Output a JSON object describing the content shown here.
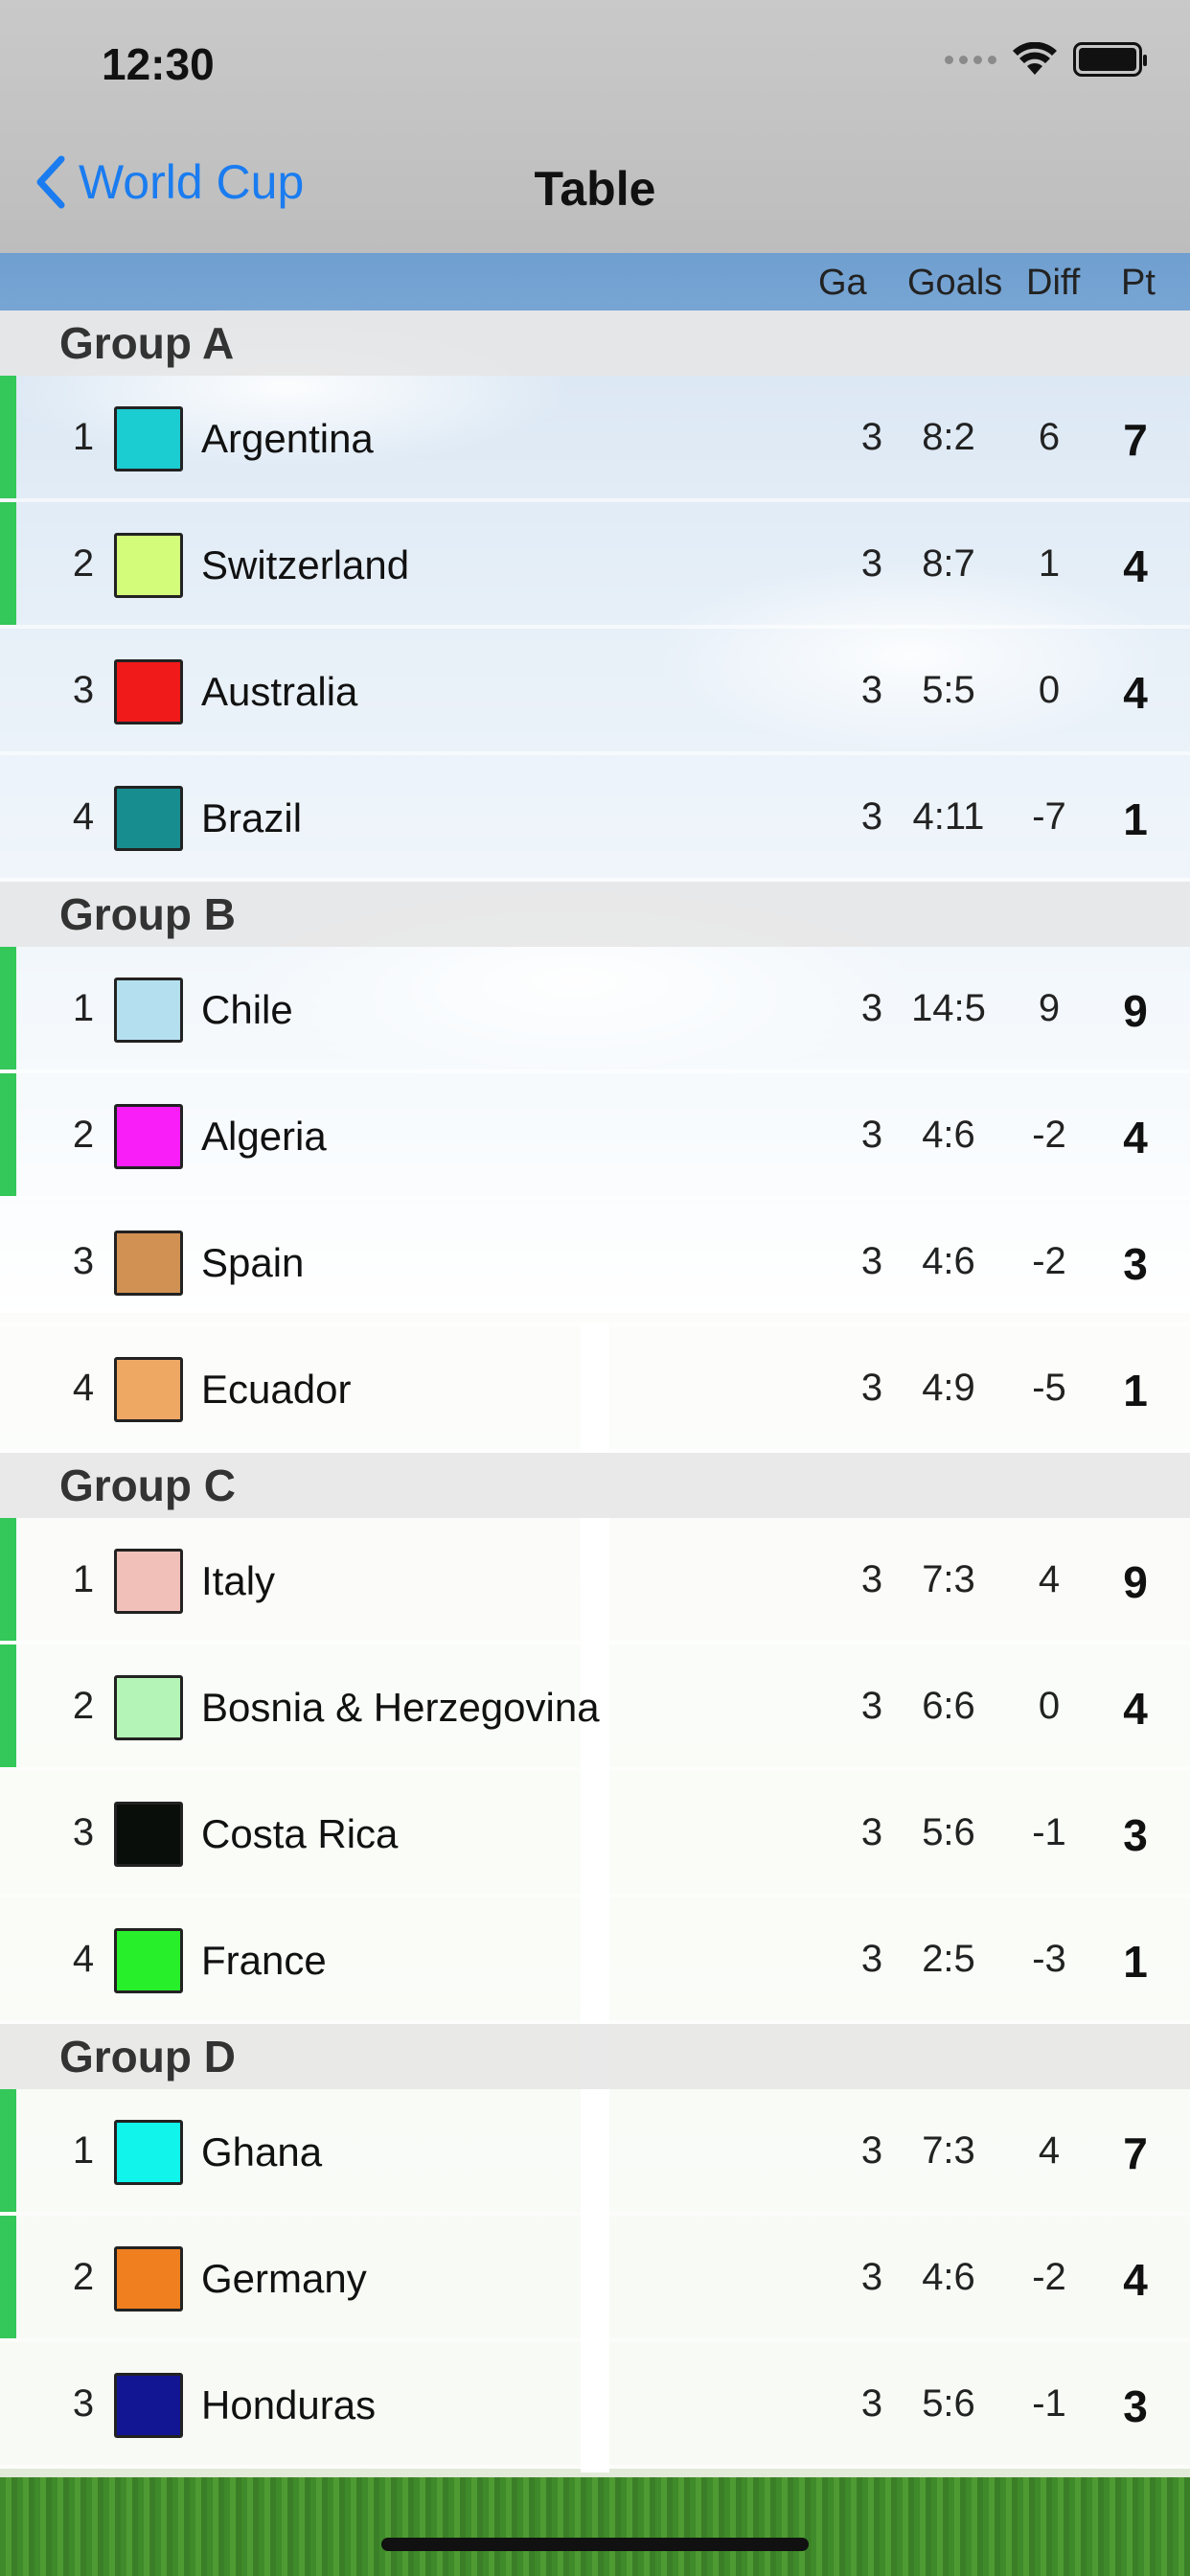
{
  "status_bar": {
    "time": "12:30"
  },
  "nav": {
    "back_label": "World Cup",
    "title": "Table"
  },
  "columns": {
    "games": "Ga",
    "goals": "Goals",
    "diff": "Diff",
    "points": "Pt"
  },
  "colors": {
    "accent": "#1a7cf0",
    "qualified": "#34c759"
  },
  "groups": [
    {
      "name": "Group A",
      "teams": [
        {
          "pos": "1",
          "name": "Argentina",
          "color": "#1bccd1",
          "games": "3",
          "goals": "8:2",
          "diff": "6",
          "points": "7",
          "qualified": true
        },
        {
          "pos": "2",
          "name": "Switzerland",
          "color": "#d3fc7a",
          "games": "3",
          "goals": "8:7",
          "diff": "1",
          "points": "4",
          "qualified": true
        },
        {
          "pos": "3",
          "name": "Australia",
          "color": "#f01a1a",
          "games": "3",
          "goals": "5:5",
          "diff": "0",
          "points": "4",
          "qualified": false
        },
        {
          "pos": "4",
          "name": "Brazil",
          "color": "#178d8f",
          "games": "3",
          "goals": "4:11",
          "diff": "-7",
          "points": "1",
          "qualified": false
        }
      ]
    },
    {
      "name": "Group B",
      "teams": [
        {
          "pos": "1",
          "name": "Chile",
          "color": "#b4dfef",
          "games": "3",
          "goals": "14:5",
          "diff": "9",
          "points": "9",
          "qualified": true
        },
        {
          "pos": "2",
          "name": "Algeria",
          "color": "#f91ef7",
          "games": "3",
          "goals": "4:6",
          "diff": "-2",
          "points": "4",
          "qualified": true
        },
        {
          "pos": "3",
          "name": "Spain",
          "color": "#d09152",
          "games": "3",
          "goals": "4:6",
          "diff": "-2",
          "points": "3",
          "qualified": false
        },
        {
          "pos": "4",
          "name": "Ecuador",
          "color": "#efa764",
          "games": "3",
          "goals": "4:9",
          "diff": "-5",
          "points": "1",
          "qualified": false
        }
      ]
    },
    {
      "name": "Group C",
      "teams": [
        {
          "pos": "1",
          "name": "Italy",
          "color": "#f1c0b8",
          "games": "3",
          "goals": "7:3",
          "diff": "4",
          "points": "9",
          "qualified": true
        },
        {
          "pos": "2",
          "name": "Bosnia & Herzegovina",
          "color": "#b4f4b6",
          "games": "3",
          "goals": "6:6",
          "diff": "0",
          "points": "4",
          "qualified": true
        },
        {
          "pos": "3",
          "name": "Costa Rica",
          "color": "#0a0e0a",
          "games": "3",
          "goals": "5:6",
          "diff": "-1",
          "points": "3",
          "qualified": false
        },
        {
          "pos": "4",
          "name": "France",
          "color": "#27ef2a",
          "games": "3",
          "goals": "2:5",
          "diff": "-3",
          "points": "1",
          "qualified": false
        }
      ]
    },
    {
      "name": "Group D",
      "teams": [
        {
          "pos": "1",
          "name": "Ghana",
          "color": "#10f4ec",
          "games": "3",
          "goals": "7:3",
          "diff": "4",
          "points": "7",
          "qualified": true
        },
        {
          "pos": "2",
          "name": "Germany",
          "color": "#ef7f1f",
          "games": "3",
          "goals": "4:6",
          "diff": "-2",
          "points": "4",
          "qualified": true
        },
        {
          "pos": "3",
          "name": "Honduras",
          "color": "#121693",
          "games": "3",
          "goals": "5:6",
          "diff": "-1",
          "points": "3",
          "qualified": false
        }
      ]
    }
  ]
}
